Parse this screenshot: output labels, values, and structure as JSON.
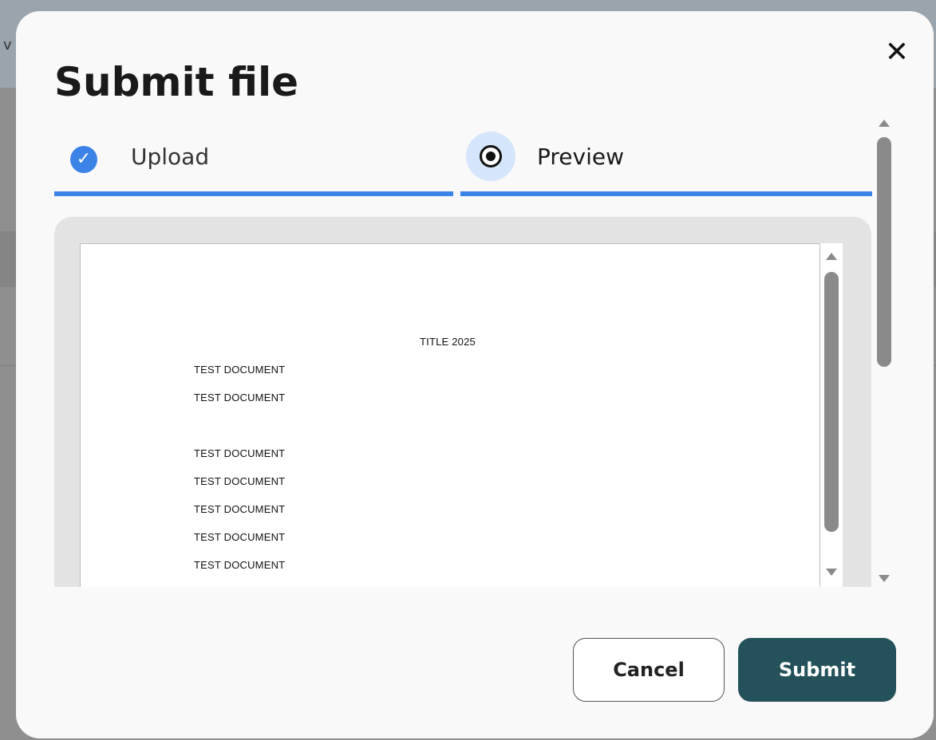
{
  "background": {
    "edge_letter": "v"
  },
  "modal": {
    "title": "Submit file",
    "close_icon": "close-icon",
    "close_glyph": "✕"
  },
  "stepper": {
    "accent_color": "#3b83e7",
    "steps": [
      {
        "label": "Upload",
        "state": "completed",
        "icon": "check-circle-icon"
      },
      {
        "label": "Preview",
        "state": "active",
        "icon": "radio-selected-icon"
      }
    ]
  },
  "document": {
    "title": "TITLE 2025",
    "lines": [
      "TEST DOCUMENT",
      "TEST DOCUMENT",
      "TEST DOCUMENT",
      "TEST DOCUMENT",
      "TEST DOCUMENT",
      "TEST DOCUMENT",
      "TEST DOCUMENT"
    ]
  },
  "actions": {
    "cancel_label": "Cancel",
    "submit_label": "Submit",
    "submit_color": "#24525a"
  }
}
